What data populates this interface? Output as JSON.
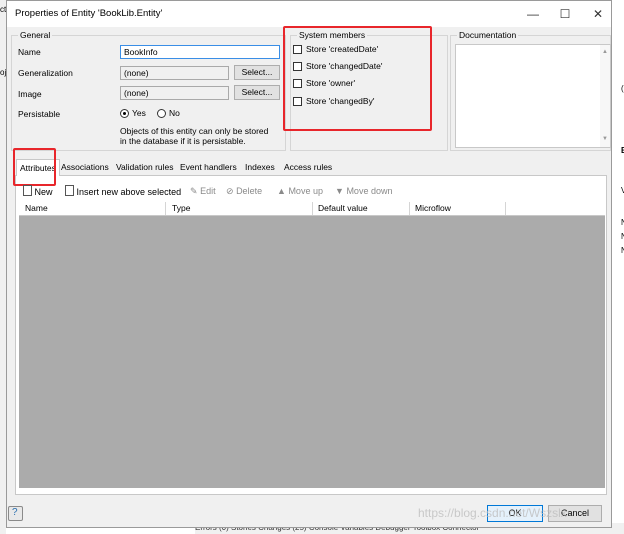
{
  "window": {
    "title": "Properties of Entity 'BookLib.Entity'",
    "minimize": "—",
    "maximize": "☐",
    "close": "✕"
  },
  "general": {
    "group_label": "General",
    "name_label": "Name",
    "name_value": "BookInfo",
    "generalization_label": "Generalization",
    "generalization_value": "(none)",
    "generalization_button": "Select...",
    "image_label": "Image",
    "image_value": "(none)",
    "image_button": "Select...",
    "persistable_label": "Persistable",
    "yes_label": "Yes",
    "no_label": "No",
    "persistable_selected": "Yes",
    "note_line1": "Objects of this entity can only be stored",
    "note_line2": "in the database if it is persistable."
  },
  "system_members": {
    "group_label": "System members",
    "items": [
      {
        "label": "Store 'createdDate'",
        "checked": false
      },
      {
        "label": "Store 'changedDate'",
        "checked": false
      },
      {
        "label": "Store 'owner'",
        "checked": false
      },
      {
        "label": "Store 'changedBy'",
        "checked": false
      }
    ]
  },
  "documentation": {
    "group_label": "Documentation"
  },
  "tabs": [
    {
      "label": "Attributes",
      "active": true
    },
    {
      "label": "Associations"
    },
    {
      "label": "Validation rules"
    },
    {
      "label": "Event handlers"
    },
    {
      "label": "Indexes"
    },
    {
      "label": "Access rules"
    }
  ],
  "toolbar": {
    "new": "New",
    "insert": "Insert new above selected",
    "edit": "Edit",
    "delete": "Delete",
    "move_up": "Move up",
    "move_down": "Move down"
  },
  "grid": {
    "columns": [
      "Name",
      "Type",
      "Default value",
      "Microflow"
    ]
  },
  "footer": {
    "ok": "OK",
    "cancel": "Cancel",
    "watermark": "https://blog.csdn.net/Wszslx"
  },
  "background": {
    "bottom_bar": "Errors (0)   Stories   Changes (25)   Console   Variables   Debugger   Toolbox   Connector",
    "left_fragments": [
      "ct",
      "oj"
    ],
    "right_fragments": [
      "(",
      "E",
      "V",
      "N",
      "N",
      "N"
    ]
  },
  "colors": {
    "highlight": "#e8262b",
    "grid_bg": "#ababab",
    "accent": "#0078d7"
  }
}
